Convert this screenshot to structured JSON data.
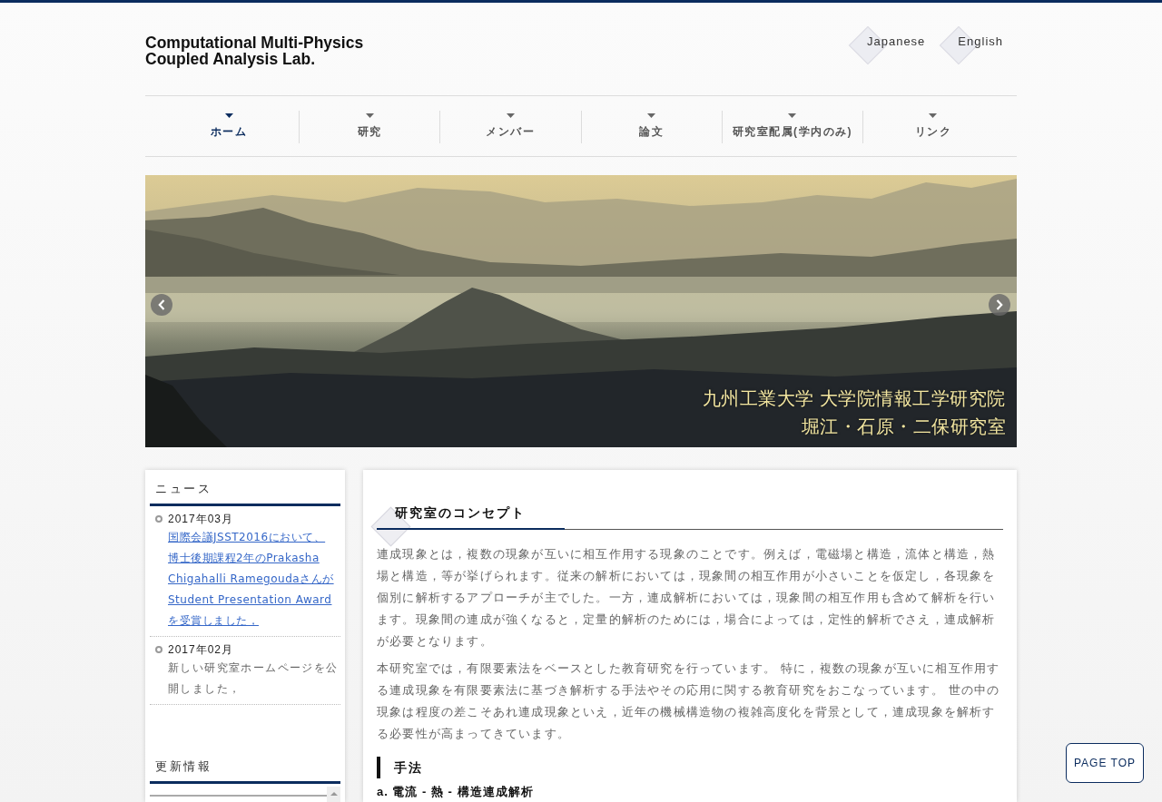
{
  "header": {
    "logo": [
      "Computational Multi-Physics",
      "Coupled Analysis Lab."
    ],
    "languages": [
      {
        "label": "Japanese"
      },
      {
        "label": "English"
      }
    ]
  },
  "nav": [
    {
      "label": "ホーム",
      "selected": true
    },
    {
      "label": "研究",
      "selected": false
    },
    {
      "label": "メンバー",
      "selected": false
    },
    {
      "label": "論文",
      "selected": false
    },
    {
      "label": "研究室配属(学内のみ)",
      "selected": false
    },
    {
      "label": "リンク",
      "selected": false
    }
  ],
  "slider": {
    "caption": [
      "九州工業大学 大学院情報工学研究院",
      "堀江・石原・二保研究室"
    ]
  },
  "sidebar": {
    "news": {
      "title": "ニュース",
      "items": [
        {
          "date": "2017年03月",
          "kind": "link",
          "text": "国際会議JSST2016において、博士後期課程2年のPrakasha Chigahalli Ramegoudaさんが Student Presentation Awardを受賞しました，"
        },
        {
          "date": "2017年02月",
          "kind": "text",
          "text": "新しい研究室ホームページを公開しました，"
        }
      ]
    },
    "updates": {
      "title": "更新情報"
    }
  },
  "main": {
    "title": "研究室のコンセプト",
    "paragraphs": [
      "連成現象とは，複数の現象が互いに相互作用する現象のことです。例えば，電磁場と構造，流体と構造，熱場と構造，等が挙げられます。従来の解析においては，現象間の相互作用が小さいことを仮定し，各現象を個別に解析するアプローチが主でした。一方，連成解析においては，現象間の相互作用も含めて解析を行います。現象間の連成が強くなると，定量的解析のためには，場合によっては，定性的解析でさえ，連成解析が必要となります。",
      "本研究室では，有限要素法をベースとした教育研究を行っています。 特に，複数の現象が互いに相互作用する連成現象を有限要素法に基づき解析する手法やその応用に関する教育研究をおこなっています。 世の中の現象は程度の差こそあれ連成現象といえ，近年の機械構造物の複雑高度化を背景として，連成現象を解析する必要性が高まってきています。"
    ],
    "section": "手法",
    "subsection": "a. 電流 - 熱 - 構造連成解析"
  },
  "page_top": "PAGE TOP"
}
